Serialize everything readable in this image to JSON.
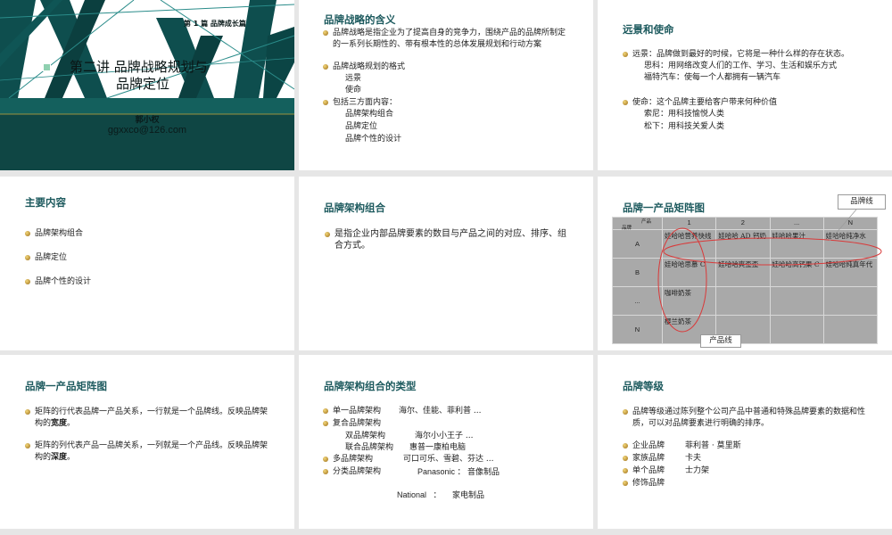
{
  "cover": {
    "tilde": "~",
    "section": "第 1 篇  品牌成长篇",
    "title_line1": "第二讲  品牌战略规划与",
    "title_line2": "品牌定位",
    "author": "郭小权",
    "email": "ggxxco@126.com"
  },
  "slide2": {
    "title": "品牌战略的含义",
    "items": [
      "品牌战略是指企业为了提高自身的竞争力，围绕产品的品牌所制定的一系列长期性的、带有根本性的总体发展规划和行动方案",
      "品牌战略规划的格式",
      "包括三方面内容："
    ],
    "format_sub": [
      "远景",
      "使命"
    ],
    "content_sub": [
      "品牌架构组合",
      "品牌定位",
      "品牌个性的设计"
    ]
  },
  "slide3": {
    "title": "远景和使命",
    "vision": "远景：品牌做到最好的时候，它将是一种什么样的存在状态。",
    "vision_sub": [
      "思科：用网络改变人们的工作、学习、生活和娱乐方式",
      "福特汽车：使每一个人都拥有一辆汽车"
    ],
    "mission": "使命：这个品牌主要给客户带来何种价值",
    "mission_sub": [
      "索尼：用科技愉悦人类",
      "松下：用科技关爱人类"
    ]
  },
  "slide4": {
    "title": "主要内容",
    "items": [
      "品牌架构组合",
      "品牌定位",
      "品牌个性的设计"
    ]
  },
  "slide5": {
    "title": "品牌架构组合",
    "text": "是指企业内部品牌要素的数目与产品之间的对应、排序、组合方式。"
  },
  "slide6": {
    "title": "品牌一产品矩阵图",
    "callout_line": "品牌线",
    "callout_product": "产品线",
    "matrix": {
      "corner_product": "产品",
      "corner_brand": "品牌",
      "cols": [
        "1",
        "2",
        "...",
        "N"
      ],
      "rows": [
        {
          "h": "A",
          "c": [
            "娃哈哈营养快线",
            "娃哈哈 AD 钙奶",
            "娃哈哈果汁",
            "娃哈哈纯净水"
          ]
        },
        {
          "h": "B",
          "c": [
            "娃哈哈思慕 C",
            "娃哈哈爽歪歪",
            "娃哈哈高钙果 C",
            "娃哈哈纯真年代"
          ]
        },
        {
          "h": "...",
          "c": [
            "咖啡奶茶",
            "",
            "",
            ""
          ]
        },
        {
          "h": "N",
          "c": [
            "樱兰奶茶",
            "",
            "",
            ""
          ]
        }
      ]
    }
  },
  "slide7": {
    "title": "品牌一产品矩阵图",
    "item1_pre": "矩阵的行代表品牌一产品关系，一行就是一个品牌线。反映品牌架构的",
    "item1_em": "宽度",
    "item1_post": "。",
    "item2_pre": "矩阵的列代表产品一品牌关系，一列就是一个产品线。反映品牌架构的",
    "item2_em": "深度",
    "item2_post": "。"
  },
  "slide8": {
    "title": "品牌架构组合的类型",
    "rows": [
      {
        "label": "单一品牌架构",
        "value": "海尔、佳能、菲利普 ..."
      },
      {
        "label": "复合品牌架构",
        "value": ""
      },
      {
        "label": "多品牌架构",
        "value": "可口可乐、雪碧、芬达 ..."
      },
      {
        "label": "分类品牌架构",
        "value": "Panasonic ：     音像制品"
      }
    ],
    "sub_rows": [
      {
        "label": "双品牌架构",
        "value": "海尔小小王子 ..."
      },
      {
        "label": "联合品牌架构",
        "value": "惠普一康柏电脑"
      }
    ],
    "national": "National   ：     家电制品"
  },
  "slide9": {
    "title": "品牌等级",
    "intro": "品牌等级通过陈列整个公司产品中普通和特殊品牌要素的数据和性质，可以对品牌要素进行明确的排序。",
    "rows": [
      {
        "label": "企业品牌",
        "value": "菲利普 · 莫里斯"
      },
      {
        "label": "家族品牌",
        "value": "卡夫"
      },
      {
        "label": "单个品牌",
        "value": "士力架"
      },
      {
        "label": "修饰品牌",
        "value": ""
      }
    ]
  }
}
